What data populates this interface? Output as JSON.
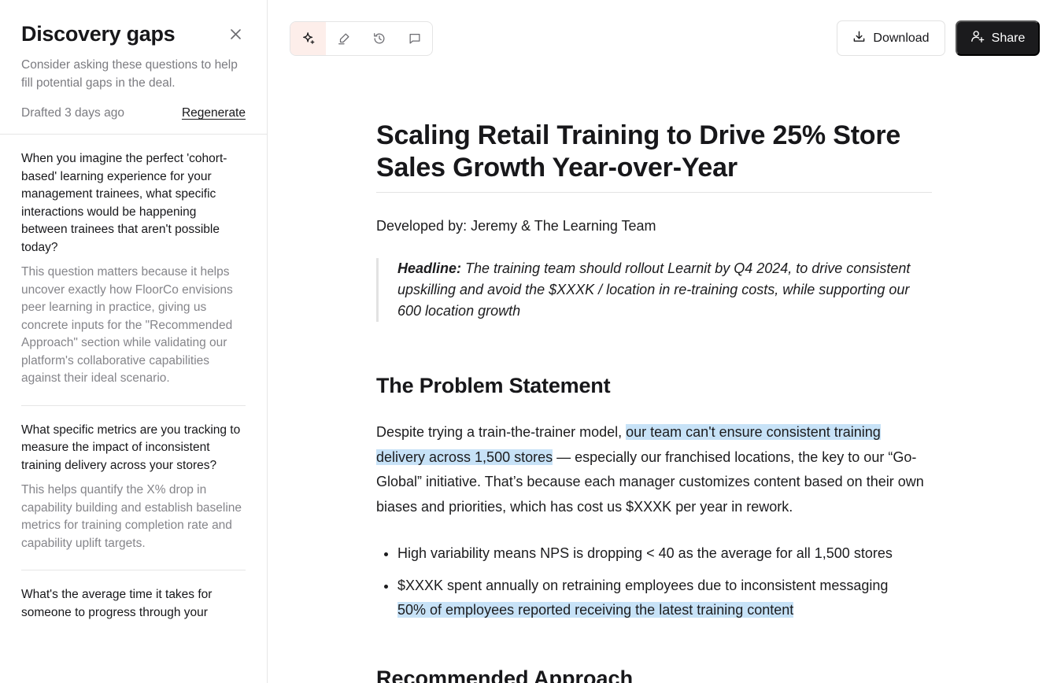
{
  "sidebar": {
    "title": "Discovery gaps",
    "description": "Consider asking these questions to help fill potential gaps in the deal.",
    "drafted": "Drafted 3 days ago",
    "regenerate_label": "Regenerate",
    "questions": [
      {
        "question": "When you imagine the perfect 'cohort-based' learning experience for your management trainees, what specific interactions would be happening between trainees that aren't possible today?",
        "rationale": "This question matters because it helps uncover exactly how FloorCo envisions peer learning in practice, giving us concrete inputs for the \"Recommended Approach\" section while validating our platform's collaborative capabilities against their ideal scenario."
      },
      {
        "question": "What specific metrics are you tracking to measure the impact of inconsistent training delivery across your stores?",
        "rationale": "This helps quantify the X% drop in capability building and establish baseline metrics for training completion rate and capability uplift targets."
      },
      {
        "question": "What's the average time it takes for someone to progress through your",
        "rationale": ""
      }
    ]
  },
  "toolbar": {
    "icons": [
      "sparkle-icon",
      "highlighter-icon",
      "history-icon",
      "comment-icon"
    ],
    "download_label": "Download",
    "share_label": "Share"
  },
  "doc": {
    "title": "Scaling Retail Training to Drive 25% Store Sales Growth Year-over-Year",
    "developed_by": "Developed by: Jeremy & The Learning Team",
    "headline_label": "Headline:",
    "headline_text": " The training team should rollout Learnit by Q4 2024, to drive consistent upskilling and avoid the $XXXK / location in re-training costs, while supporting our 600 location growth",
    "problem_heading": "The Problem Statement",
    "problem_pre": "Despite trying a train-the-trainer model, ",
    "problem_highlight": "our team can't ensure consistent training delivery across 1,500 stores",
    "problem_post": " — especially our franchised locations, the key to our “Go-Global” initiative. That’s because each manager customizes content based on their own biases and priorities, which has cost us $XXXK per year in rework.",
    "bullet_1": "High variability means NPS is dropping < 40 as the average for all 1,500 stores",
    "bullet_2": "$XXXK spent annually on retraining employees due to inconsistent messaging",
    "bullet_2_highlight": "50% of employees reported receiving the latest training content",
    "next_heading": "Recommended Approach"
  },
  "colors": {
    "highlight": "#c7e2f7",
    "share_bg": "#1b1b1d",
    "active_tool_bg": "#fdeeea"
  }
}
